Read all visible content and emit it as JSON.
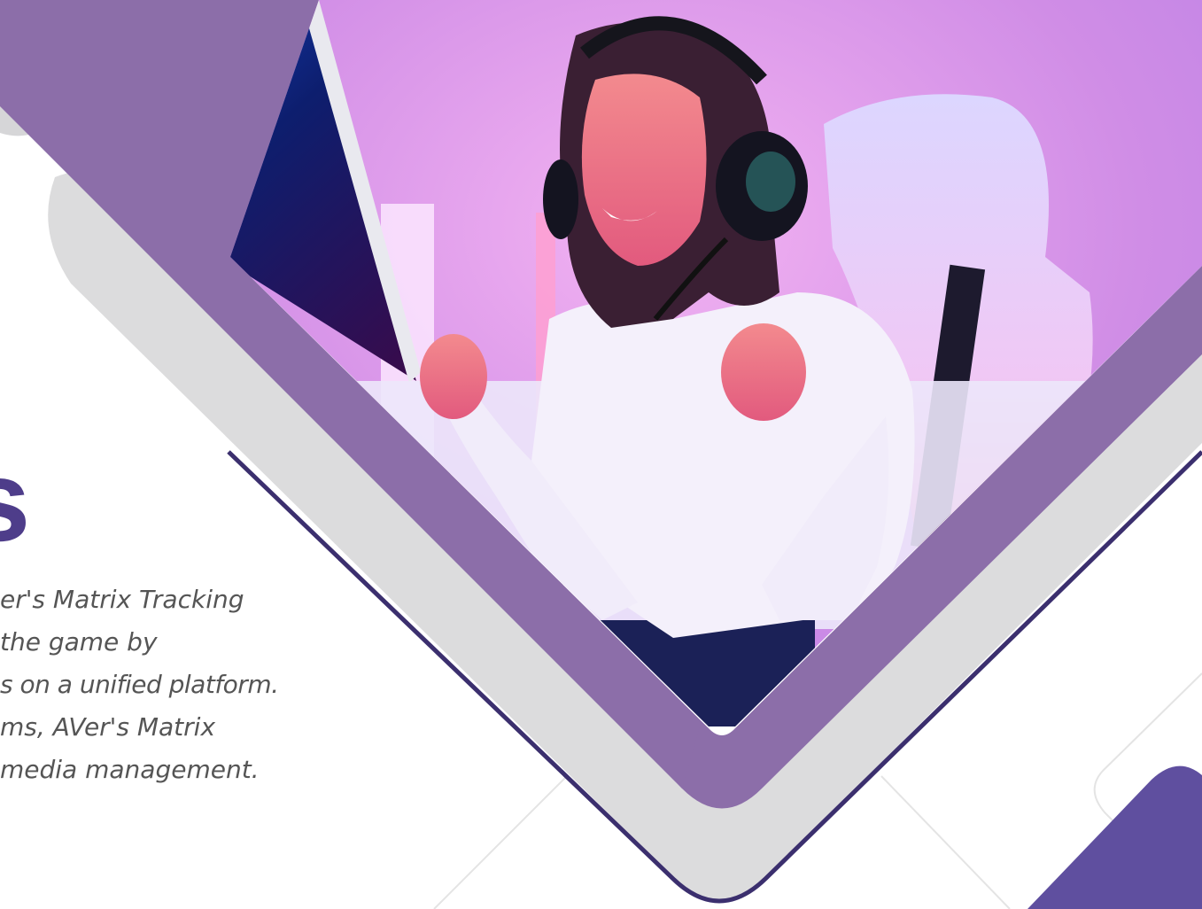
{
  "colors": {
    "purple_band": "#8c6ea9",
    "grey_band": "#dcdcdd",
    "navy_line": "#3b2f6e",
    "corner_block": "#5f4f9f",
    "title_text": "#4e3d8a",
    "body_text": "#555555"
  },
  "hero": {
    "title_fragment": "s",
    "body_lines": [
      "er's Matrix Tracking",
      "the game by",
      "s on a unified platform.",
      "ms, AVer's Matrix",
      "media management."
    ]
  },
  "icons": {
    "photo": "gaming-photo-icon"
  }
}
